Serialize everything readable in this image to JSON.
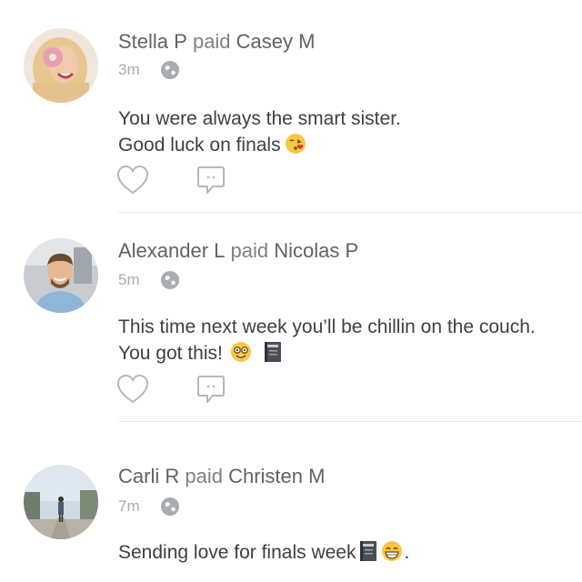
{
  "feed": {
    "items": [
      {
        "sender": "Stella P",
        "verb": "paid",
        "recipient": "Casey M",
        "time": "3m",
        "message_lines": [
          "You were always the smart sister.",
          "Good luck on finals"
        ],
        "emojis": [
          "kissing-heart-emoji"
        ],
        "privacy_icon": "globe-icon",
        "actions": [
          "heart-icon",
          "comment-icon"
        ]
      },
      {
        "sender": "Alexander L",
        "verb": "paid",
        "recipient": "Nicolas P",
        "time": "5m",
        "message_lines": [
          "This time next week you’ll be chillin on the couch.",
          "You got this!"
        ],
        "emojis": [
          "nerd-face-emoji",
          "notebook-emoji"
        ],
        "privacy_icon": "globe-icon",
        "actions": [
          "heart-icon",
          "comment-icon"
        ]
      },
      {
        "sender": "Carli R",
        "verb": "paid",
        "recipient": "Christen M",
        "time": "7m",
        "message_lines": [
          "Sending love for finals week"
        ],
        "message_suffix": ".",
        "emojis": [
          "notebook-emoji",
          "grinning-face-emoji"
        ],
        "privacy_icon": "globe-icon"
      }
    ]
  },
  "colors": {
    "name_text": "#5f6368",
    "meta_text": "#a9adb2",
    "message_text": "#3d4045",
    "icon_stroke": "#b4b8bd",
    "divider": "#e9eaec"
  }
}
